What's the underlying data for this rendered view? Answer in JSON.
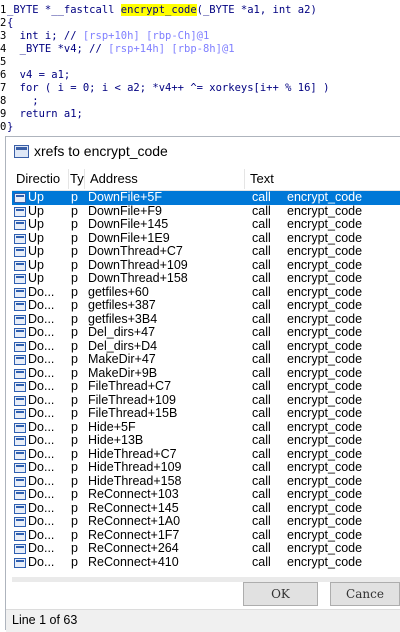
{
  "code": {
    "lines": [
      {
        "num": "1",
        "pre": "_BYTE *__fastcall ",
        "hl": "encrypt_code",
        "post": "(_BYTE *a1, int a2)",
        "comment": ""
      },
      {
        "num": "2",
        "pre": "{",
        "hl": "",
        "post": "",
        "comment": ""
      },
      {
        "num": "3",
        "pre": "  int i; // ",
        "hl": "",
        "post": "",
        "comment": "[rsp+10h] [rbp-Ch]@1"
      },
      {
        "num": "4",
        "pre": "  _BYTE *v4; // ",
        "hl": "",
        "post": "",
        "comment": "[rsp+14h] [rbp-8h]@1"
      },
      {
        "num": "5",
        "pre": "",
        "hl": "",
        "post": "",
        "comment": ""
      },
      {
        "num": "6",
        "pre": "  v4 = a1;",
        "hl": "",
        "post": "",
        "comment": ""
      },
      {
        "num": "7",
        "pre": "  for ( i = 0; i < a2; *v4++ ^= xorkeys[i++ % 16] )",
        "hl": "",
        "post": "",
        "comment": ""
      },
      {
        "num": "8",
        "pre": "    ;",
        "hl": "",
        "post": "",
        "comment": ""
      },
      {
        "num": "9",
        "pre": "  return a1;",
        "hl": "",
        "post": "",
        "comment": ""
      },
      {
        "num": "0",
        "pre": "}",
        "hl": "",
        "post": "",
        "comment": ""
      }
    ]
  },
  "dialog": {
    "title": "xrefs to encrypt_code",
    "columns": [
      "Directio",
      "Ty",
      "Address",
      "Text"
    ],
    "rows": [
      {
        "dir": "Up",
        "type": "p",
        "address": "DownFile+5F",
        "op": "call",
        "target": "encrypt_code"
      },
      {
        "dir": "Up",
        "type": "p",
        "address": "DownFile+F9",
        "op": "call",
        "target": "encrypt_code"
      },
      {
        "dir": "Up",
        "type": "p",
        "address": "DownFile+145",
        "op": "call",
        "target": "encrypt_code"
      },
      {
        "dir": "Up",
        "type": "p",
        "address": "DownFile+1E9",
        "op": "call",
        "target": "encrypt_code"
      },
      {
        "dir": "Up",
        "type": "p",
        "address": "DownThread+C7",
        "op": "call",
        "target": "encrypt_code"
      },
      {
        "dir": "Up",
        "type": "p",
        "address": "DownThread+109",
        "op": "call",
        "target": "encrypt_code"
      },
      {
        "dir": "Up",
        "type": "p",
        "address": "DownThread+158",
        "op": "call",
        "target": "encrypt_code"
      },
      {
        "dir": "Do...",
        "type": "p",
        "address": "getfiles+60",
        "op": "call",
        "target": "encrypt_code"
      },
      {
        "dir": "Do...",
        "type": "p",
        "address": "getfiles+387",
        "op": "call",
        "target": "encrypt_code"
      },
      {
        "dir": "Do...",
        "type": "p",
        "address": "getfiles+3B4",
        "op": "call",
        "target": "encrypt_code"
      },
      {
        "dir": "Do...",
        "type": "p",
        "address": "Del_dirs+47",
        "op": "call",
        "target": "encrypt_code"
      },
      {
        "dir": "Do...",
        "type": "p",
        "address": "Del_dirs+D4",
        "op": "call",
        "target": "encrypt_code"
      },
      {
        "dir": "Do...",
        "type": "p",
        "address": "MakeDir+47",
        "op": "call",
        "target": "encrypt_code"
      },
      {
        "dir": "Do...",
        "type": "p",
        "address": "MakeDir+9B",
        "op": "call",
        "target": "encrypt_code"
      },
      {
        "dir": "Do...",
        "type": "p",
        "address": "FileThread+C7",
        "op": "call",
        "target": "encrypt_code"
      },
      {
        "dir": "Do...",
        "type": "p",
        "address": "FileThread+109",
        "op": "call",
        "target": "encrypt_code"
      },
      {
        "dir": "Do...",
        "type": "p",
        "address": "FileThread+15B",
        "op": "call",
        "target": "encrypt_code"
      },
      {
        "dir": "Do...",
        "type": "p",
        "address": "Hide+5F",
        "op": "call",
        "target": "encrypt_code"
      },
      {
        "dir": "Do...",
        "type": "p",
        "address": "Hide+13B",
        "op": "call",
        "target": "encrypt_code"
      },
      {
        "dir": "Do...",
        "type": "p",
        "address": "HideThread+C7",
        "op": "call",
        "target": "encrypt_code"
      },
      {
        "dir": "Do...",
        "type": "p",
        "address": "HideThread+109",
        "op": "call",
        "target": "encrypt_code"
      },
      {
        "dir": "Do...",
        "type": "p",
        "address": "HideThread+158",
        "op": "call",
        "target": "encrypt_code"
      },
      {
        "dir": "Do...",
        "type": "p",
        "address": "ReConnect+103",
        "op": "call",
        "target": "encrypt_code"
      },
      {
        "dir": "Do...",
        "type": "p",
        "address": "ReConnect+145",
        "op": "call",
        "target": "encrypt_code"
      },
      {
        "dir": "Do...",
        "type": "p",
        "address": "ReConnect+1A0",
        "op": "call",
        "target": "encrypt_code"
      },
      {
        "dir": "Do...",
        "type": "p",
        "address": "ReConnect+1F7",
        "op": "call",
        "target": "encrypt_code"
      },
      {
        "dir": "Do...",
        "type": "p",
        "address": "ReConnect+264",
        "op": "call",
        "target": "encrypt_code"
      },
      {
        "dir": "Do...",
        "type": "p",
        "address": "ReConnect+410",
        "op": "call",
        "target": "encrypt_code"
      }
    ],
    "selected_row": 0,
    "ok_label": "OK",
    "cancel_label": "Cance",
    "status": "Line 1 of 63"
  },
  "colors": {
    "selection": "#0078d7",
    "highlight": "#ffff00",
    "code_text": "#000080",
    "comment": "#8080ff"
  }
}
